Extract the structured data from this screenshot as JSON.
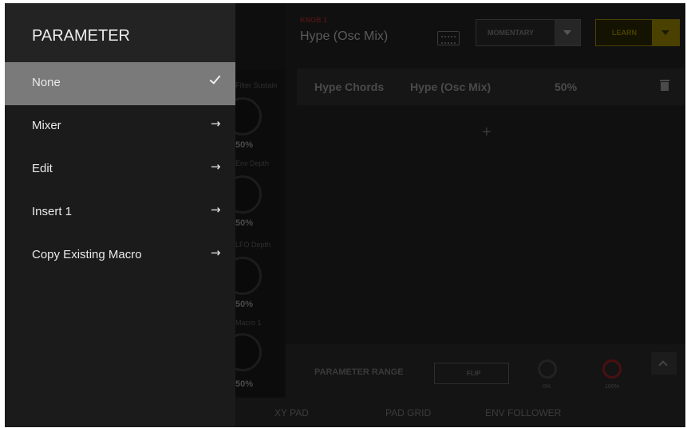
{
  "header": {
    "macro_label": "KNOB 1",
    "macro_name": "Hype (Osc Mix)",
    "mode_value": "MOMENTARY",
    "learn_label": "LEARN"
  },
  "knobs": [
    {
      "label": "Filter Sustain",
      "value": "50%"
    },
    {
      "label": "Env Depth",
      "value": "50%"
    },
    {
      "label": "LFO Depth",
      "value": "50%"
    },
    {
      "label": "Macro 1",
      "value": "50%"
    }
  ],
  "assignment": {
    "target": "Hype Chords",
    "parameter": "Hype (Osc Mix)",
    "amount": "50%"
  },
  "add_symbol": "+",
  "range": {
    "label": "PARAMETER RANGE",
    "flip_label": "FLIP",
    "min_value": "0%",
    "max_value": "100%"
  },
  "bottom_tabs": [
    "XY PAD",
    "PAD GRID",
    "ENV FOLLOWER"
  ],
  "parameter_menu": {
    "title": "PARAMETER",
    "items": [
      {
        "label": "None",
        "icon": "check-icon",
        "selected": true
      },
      {
        "label": "Mixer",
        "icon": "arrow-right-icon",
        "arrow": "→"
      },
      {
        "label": "Edit",
        "icon": "arrow-right-icon",
        "arrow": "→"
      },
      {
        "label": "Insert 1",
        "icon": "arrow-right-icon",
        "arrow": "→"
      },
      {
        "label": "Copy Existing Macro",
        "icon": "arrow-right-icon",
        "arrow": "→"
      }
    ]
  },
  "colors": {
    "panel_bg": "#1b1b1b",
    "selected_bg": "#7a7a7a",
    "learn_accent": "#4a4200",
    "macro_label_red": "#4a1414"
  }
}
